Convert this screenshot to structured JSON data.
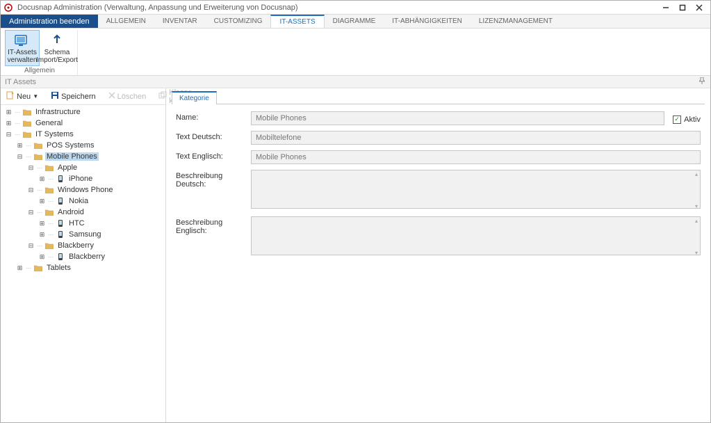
{
  "window": {
    "title": "Docusnap Administration (Verwaltung, Anpassung und Erweiterung von Docusnap)"
  },
  "tabs": {
    "admin_btn": "Administration beenden",
    "items": [
      "ALLGEMEIN",
      "INVENTAR",
      "CUSTOMIZING",
      "IT-ASSETS",
      "DIAGRAMME",
      "IT-ABHÄNGIGKEITEN",
      "LIZENZMANAGEMENT"
    ],
    "active_index": 3
  },
  "ribbon": {
    "group_title": "Allgemein",
    "btn_manage": "IT-Assets verwalten",
    "btn_schema": "Schema Import/Export"
  },
  "section_title": "IT Assets",
  "toolbar": {
    "neu": "Neu",
    "speichern": "Speichern",
    "loeschen": "Löschen",
    "klonen": "Klasse klonen"
  },
  "tree": [
    {
      "label": "Infrastructure",
      "depth": 0,
      "type": "folder",
      "toggle": "+"
    },
    {
      "label": "General",
      "depth": 0,
      "type": "folder",
      "toggle": "+"
    },
    {
      "label": "IT Systems",
      "depth": 0,
      "type": "folder",
      "toggle": "-"
    },
    {
      "label": "POS Systems",
      "depth": 1,
      "type": "folder",
      "toggle": "+"
    },
    {
      "label": "Mobile Phones",
      "depth": 1,
      "type": "folder",
      "toggle": "-",
      "selected": true
    },
    {
      "label": "Apple",
      "depth": 2,
      "type": "folder",
      "toggle": "-"
    },
    {
      "label": "iPhone",
      "depth": 3,
      "type": "class",
      "toggle": "+"
    },
    {
      "label": "Windows Phone",
      "depth": 2,
      "type": "folder",
      "toggle": "-"
    },
    {
      "label": "Nokia",
      "depth": 3,
      "type": "class",
      "toggle": "+"
    },
    {
      "label": "Android",
      "depth": 2,
      "type": "folder",
      "toggle": "-"
    },
    {
      "label": "HTC",
      "depth": 3,
      "type": "class",
      "toggle": "+"
    },
    {
      "label": "Samsung",
      "depth": 3,
      "type": "class",
      "toggle": "+"
    },
    {
      "label": "Blackberry",
      "depth": 2,
      "type": "folder",
      "toggle": "-"
    },
    {
      "label": "Blackberry",
      "depth": 3,
      "type": "class",
      "toggle": "+"
    },
    {
      "label": "Tablets",
      "depth": 1,
      "type": "folder",
      "toggle": "+"
    }
  ],
  "prop_tab": "Kategorie",
  "form": {
    "name_label": "Name:",
    "name_value": "Mobile Phones",
    "active_label": "Aktiv",
    "active_checked": true,
    "text_de_label": "Text Deutsch:",
    "text_de_value": "Mobiltelefone",
    "text_en_label": "Text Englisch:",
    "text_en_value": "Mobile Phones",
    "desc_de_label": "Beschreibung Deutsch:",
    "desc_de_value": "",
    "desc_en_label": "Beschreibung Englisch:",
    "desc_en_value": ""
  }
}
